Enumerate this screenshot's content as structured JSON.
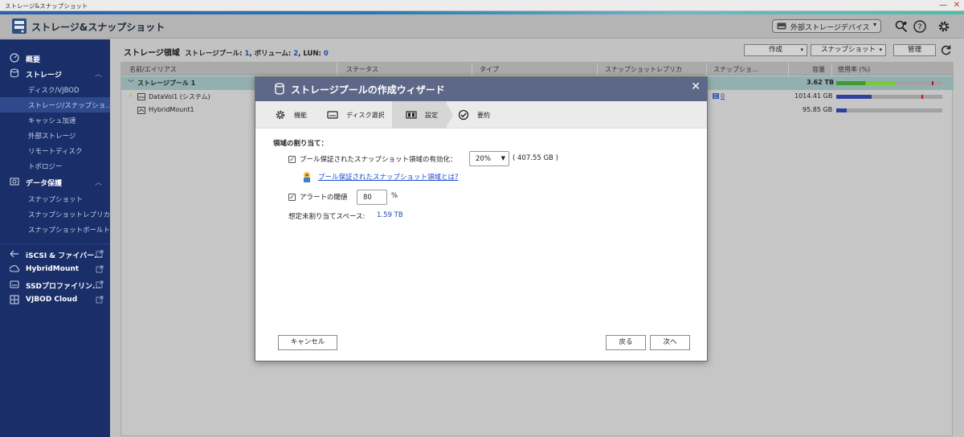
{
  "window": {
    "title": "ストレージ&スナップショット",
    "minimize": "—",
    "close": "✕"
  },
  "app": {
    "title": "ストレージ&スナップショット",
    "external_device_label": "外部ストレージデバイス",
    "header_icons": [
      "search-settings-icon",
      "help-icon",
      "gear-icon"
    ]
  },
  "sidebar": {
    "items": [
      {
        "label": "概要",
        "type": "top",
        "icon": "dashboard-icon"
      },
      {
        "label": "ストレージ",
        "type": "group",
        "icon": "storage-icon"
      },
      {
        "label": "ディスク/VJBOD",
        "type": "sub"
      },
      {
        "label": "ストレージ/スナップショ...",
        "type": "sub",
        "active": true
      },
      {
        "label": "キャッシュ加速",
        "type": "sub"
      },
      {
        "label": "外部ストレージ",
        "type": "sub"
      },
      {
        "label": "リモートディスク",
        "type": "sub"
      },
      {
        "label": "トポロジー",
        "type": "sub"
      },
      {
        "label": "データ保護",
        "type": "group",
        "icon": "data-protection-icon"
      },
      {
        "label": "スナップショット",
        "type": "sub"
      },
      {
        "label": "スナップショットレプリカ",
        "type": "sub"
      },
      {
        "label": "スナップショットボールト",
        "type": "sub"
      },
      {
        "label": "iSCSI & ファイバー...",
        "type": "external",
        "icon": "iscsi-icon"
      },
      {
        "label": "HybridMount",
        "type": "external",
        "icon": "hybridmount-icon"
      },
      {
        "label": "SSDプロファイリン...",
        "type": "external",
        "icon": "ssd-icon"
      },
      {
        "label": "VJBOD Cloud",
        "type": "external",
        "icon": "vjbod-cloud-icon"
      }
    ]
  },
  "main": {
    "breadcrumb": {
      "title": "ストレージ領域",
      "pools_label": "ストレージプール:",
      "pools_count": "1",
      "volumes_label": "ボリューム:",
      "volumes_count": "2",
      "lun_label": "LUN:",
      "lun_count": "0"
    },
    "toolbar": {
      "create_label": "作成",
      "snapshot_label": "スナップショット",
      "manage_label": "管理"
    },
    "table": {
      "columns": [
        "名前/エイリアス",
        "ステータス",
        "タイプ",
        "スナップショットレプリカ",
        "スナップショ...",
        "容量",
        "使用率 (%)"
      ],
      "rows": [
        {
          "name": "ストレージプール 1",
          "snap": "",
          "capacity": "3.62 TB",
          "usage": 0.55,
          "alert": 0.9,
          "color": "#3d9c2e",
          "extra_color": "#7cc93c"
        },
        {
          "name": "DataVol1 (システム)",
          "snap": "0",
          "capacity": "1014.41 GB",
          "usage": 0.33,
          "alert": 0.8,
          "color": "#2f3f9c"
        },
        {
          "name": "HybridMount1",
          "snap": "",
          "capacity": "95.85 GB",
          "usage": 0.1,
          "alert": null,
          "color": "#2f3f9c"
        }
      ]
    }
  },
  "wizard": {
    "title": "ストレージプールの作成ウィザード",
    "close": "✕",
    "steps": [
      {
        "label": "機能",
        "icon": "gear-icon"
      },
      {
        "label": "ディスク選択",
        "icon": "disk-icon"
      },
      {
        "label": "設定",
        "icon": "settings-icon",
        "active": true
      },
      {
        "label": "要約",
        "icon": "check-circle-icon"
      }
    ],
    "section_title": "領域の割り当て：",
    "snapshot_enable_label": "プール保証されたスナップショット領域の有効化：",
    "snapshot_percent": "20%",
    "snapshot_size": "( 407.55 GB )",
    "help_link": "プール保証されたスナップショット領域とは?",
    "alert_label": "アラートの閾値",
    "alert_value": "80",
    "alert_unit": "%",
    "estimate_label": "想定未割り当てスペース:",
    "estimate_value": "1.59 TB",
    "cancel_label": "キャンセル",
    "back_label": "戻る",
    "next_label": "次へ"
  }
}
